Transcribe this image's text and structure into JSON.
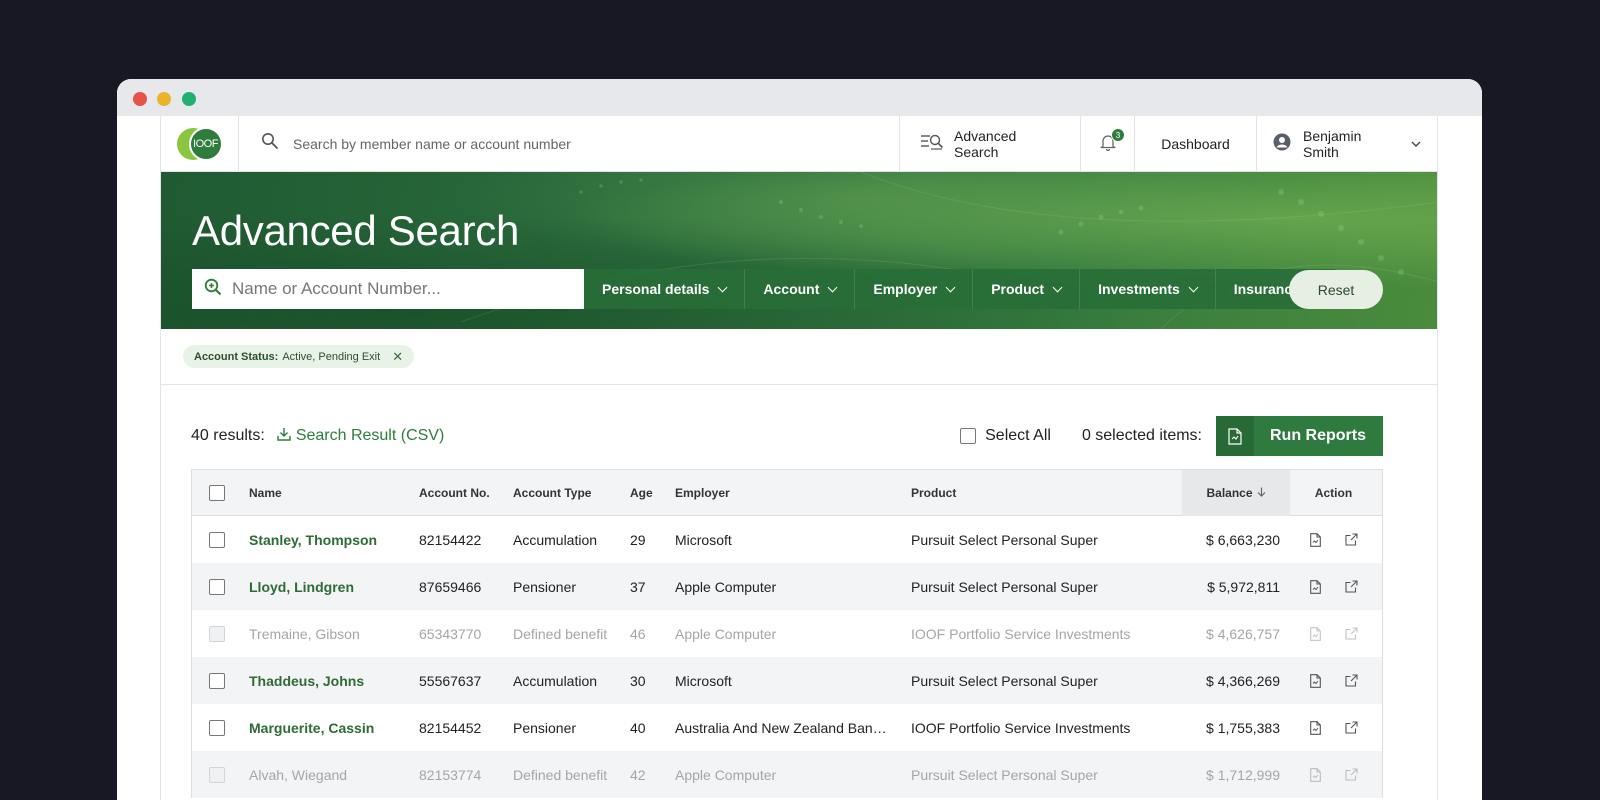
{
  "topbar": {
    "logo_text": "IOOF",
    "search_placeholder": "Search by member name or account number",
    "advanced_search_label": "Advanced Search",
    "notification_count": "3",
    "dashboard_label": "Dashboard",
    "user_name": "Benjamin Smith"
  },
  "hero": {
    "title": "Advanced Search",
    "search_placeholder": "Name or Account Number...",
    "filters": [
      "Personal details",
      "Account",
      "Employer",
      "Product",
      "Investments",
      "Insurance"
    ],
    "reset_label": "Reset"
  },
  "active_filters": [
    {
      "key": "Account Status:",
      "value": "Active, Pending Exit"
    }
  ],
  "results": {
    "count_label": "40 results:",
    "csv_label": "Search Result (CSV)",
    "select_all_label": "Select All",
    "selected_label": "0 selected items:",
    "run_reports_label": "Run Reports"
  },
  "table": {
    "columns": {
      "name": "Name",
      "account_no": "Account No.",
      "account_type": "Account Type",
      "age": "Age",
      "employer": "Employer",
      "product": "Product",
      "balance": "Balance",
      "action": "Action"
    },
    "rows": [
      {
        "name": "Stanley, Thompson",
        "account_no": "82154422",
        "account_type": "Accumulation",
        "age": "29",
        "employer": "Microsoft",
        "product": "Pursuit Select Personal Super",
        "balance": "$ 6,663,230",
        "disabled": false
      },
      {
        "name": "Lloyd, Lindgren",
        "account_no": "87659466",
        "account_type": "Pensioner",
        "age": "37",
        "employer": "Apple Computer",
        "product": "Pursuit Select Personal Super",
        "balance": "$ 5,972,811",
        "disabled": false
      },
      {
        "name": "Tremaine, Gibson",
        "account_no": "65343770",
        "account_type": "Defined benefit",
        "age": "46",
        "employer": "Apple Computer",
        "product": "IOOF Portfolio Service Investments",
        "balance": "$ 4,626,757",
        "disabled": true
      },
      {
        "name": "Thaddeus, Johns",
        "account_no": "55567637",
        "account_type": "Accumulation",
        "age": "30",
        "employer": "Microsoft",
        "product": "Pursuit Select Personal Super",
        "balance": "$ 4,366,269",
        "disabled": false
      },
      {
        "name": "Marguerite, Cassin",
        "account_no": "82154452",
        "account_type": "Pensioner",
        "age": "40",
        "employer": "Australia And New Zealand Ban…",
        "product": "IOOF Portfolio Service Investments",
        "balance": "$ 1,755,383",
        "disabled": false
      },
      {
        "name": "Alvah, Wiegand",
        "account_no": "82153774",
        "account_type": "Defined benefit",
        "age": "42",
        "employer": "Apple Computer",
        "product": "Pursuit Select Personal Super",
        "balance": "$ 1,712,999",
        "disabled": true
      }
    ]
  },
  "colors": {
    "brand_green": "#2e7d3c",
    "link_green": "#2e6b35",
    "background": "#171824"
  }
}
